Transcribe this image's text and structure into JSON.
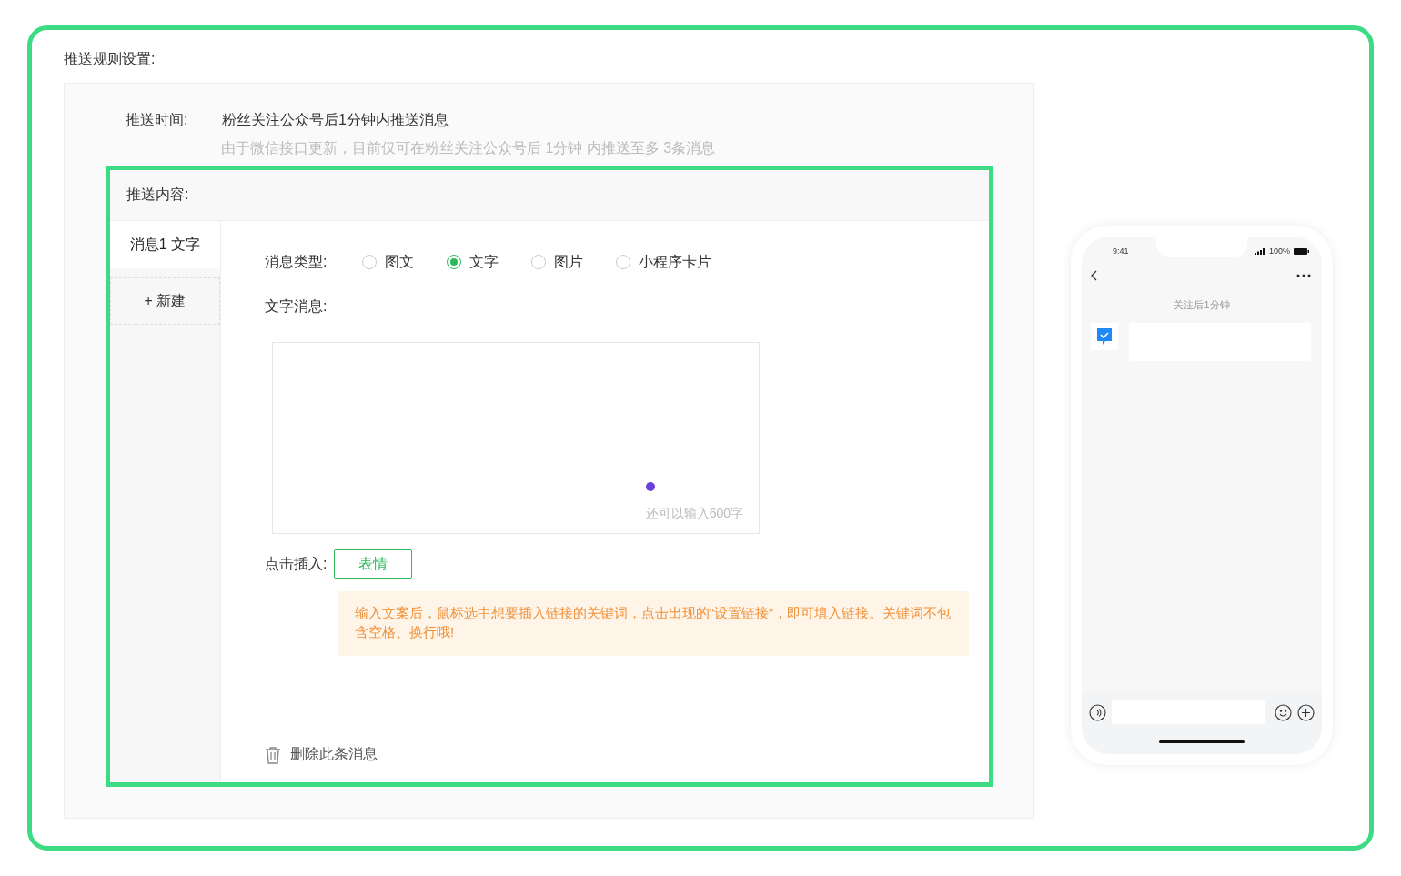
{
  "section_title": "推送规则设置:",
  "push_time": {
    "label": "推送时间:",
    "value": "粉丝关注公众号后1分钟内推送消息",
    "hint": "由于微信接口更新，目前仅可在粉丝关注公众号后 1分钟 内推送至多 3条消息"
  },
  "content": {
    "title": "推送内容:",
    "messages": [
      {
        "label": "消息1 文字",
        "selected": true
      }
    ],
    "add_button": {
      "icon": "+",
      "label": "新建"
    },
    "message_type": {
      "label": "消息类型:",
      "options": [
        {
          "label": "图文",
          "selected": false
        },
        {
          "label": "文字",
          "selected": true
        },
        {
          "label": "图片",
          "selected": false
        },
        {
          "label": "小程序卡片",
          "selected": false
        }
      ]
    },
    "text_label": "文字消息:",
    "counter": "还可以输入600字",
    "insert": {
      "label": "点击插入:",
      "button": "表情"
    },
    "notice": "输入文案后，鼠标选中想要插入链接的关键词，点击出现的“设置链接”，即可填入链接。关键词不包含空格、换行哦!",
    "delete": "删除此条消息"
  },
  "phone": {
    "time": "9:41",
    "battery": "100%",
    "caption": "关注后1分钟"
  }
}
